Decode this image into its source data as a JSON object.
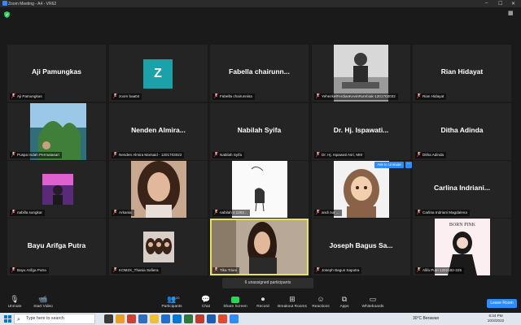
{
  "window": {
    "title": "Zoom Meeting - A4 - VR62",
    "min": "–",
    "max": "☐",
    "close": "✕"
  },
  "colors": {
    "accent": "#2d8cff",
    "share": "#23d959",
    "speaking_border": "#e8e35a",
    "avatar_teal": "#1ba1a8"
  },
  "tiles": [
    {
      "big": "Aji Pamungkas",
      "label": "Aji Pamungkas"
    },
    {
      "avatar": "Z",
      "label": "zoom baa04"
    },
    {
      "big": "Fabella  chairunn...",
      "label": "Fabella chairunnisa"
    },
    {
      "label": "YehezkelFerdianKevinRumbiak-1201703032"
    },
    {
      "big": "Rian Hidayat",
      "label": "Rian Hidayat"
    },
    {
      "label": "Puspa Indah Permatasari"
    },
    {
      "big": "Nenden  Almira...",
      "label": "Nenden Almira Marsaid - 1201703022"
    },
    {
      "big": "Nabilah Syifa",
      "label": "Nabilah Syifa"
    },
    {
      "big": "Dr. Hj.  Ispawati...",
      "label": "Dr. Hj. Ispawati Asri, MM"
    },
    {
      "big": "Ditha Adinda",
      "label": "Ditha Adinda"
    },
    {
      "label": "nabilla sungkar"
    },
    {
      "label": "Arkania"
    },
    {
      "label": "nabilah s 1202..."
    },
    {
      "label": "andi nur ..."
    },
    {
      "big": "Carlina  Indriani...",
      "label": "Carlina Indriani Magdalena"
    },
    {
      "big": "Bayu Arifga Putra",
      "label": "Bayu Arifga Putra"
    },
    {
      "label": "KOM2X_Thania Safiera"
    },
    {
      "label": "Tika Triani"
    },
    {
      "big": "Joseph Bagus Sa...",
      "label": "Joseph Bagus Saputra"
    },
    {
      "label": "Alifa Putri 1202182-225"
    }
  ],
  "ask_to_unmute": "Ask to Unmute",
  "more": "···",
  "unassigned": "6 unassigned participants",
  "toolbar": {
    "unmute": "Unmute",
    "start_video": "Start Video",
    "participants": "Participants",
    "participants_count": "20",
    "chat": "Chat",
    "share": "Share Screen",
    "record": "Record",
    "breakout": "Breakout Rooms",
    "reactions": "Reactions",
    "apps": "Apps",
    "whiteboards": "Whiteboards",
    "leave": "Leave Room"
  },
  "taskbar": {
    "search_placeholder": "Type here to search",
    "weather": "30°C  Berawan",
    "time": "6:34 PM",
    "date": "10/3/2022"
  }
}
